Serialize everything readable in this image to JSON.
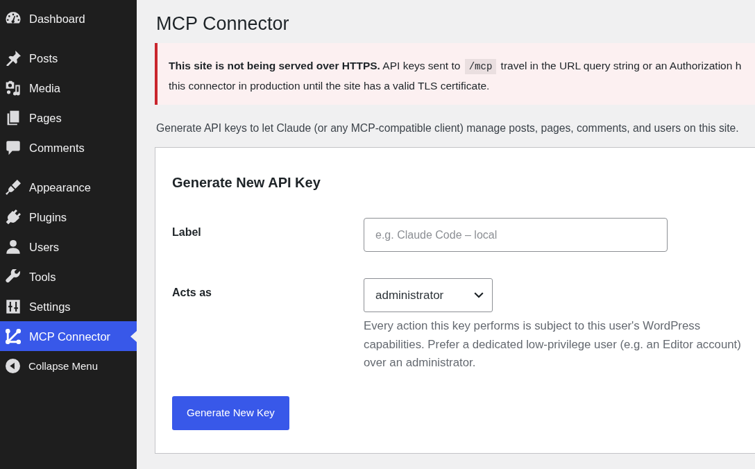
{
  "sidebar": {
    "groups": [
      {
        "items": [
          {
            "label": "Dashboard",
            "selected": false
          }
        ]
      },
      {
        "items": [
          {
            "label": "Posts",
            "selected": false
          },
          {
            "label": "Media",
            "selected": false
          },
          {
            "label": "Pages",
            "selected": false
          },
          {
            "label": "Comments",
            "selected": false
          }
        ]
      },
      {
        "items": [
          {
            "label": "Appearance",
            "selected": false
          },
          {
            "label": "Plugins",
            "selected": false
          },
          {
            "label": "Users",
            "selected": false
          },
          {
            "label": "Tools",
            "selected": false
          },
          {
            "label": "Settings",
            "selected": false
          },
          {
            "label": "MCP Connector",
            "selected": true
          }
        ]
      }
    ],
    "collapse_button": {
      "label": "Collapse Menu"
    }
  },
  "page_title": "MCP Connector",
  "notice": {
    "lines": [
      [
        {
          "kind": "text",
          "text": "**This site is not being served over HTTPS.** API keys sent to"
        },
        {
          "kind": "code",
          "text": "/mcp"
        },
        {
          "kind": "text",
          "text": "travel in the URL query string or an Authorization h"
        }
      ],
      [
        {
          "kind": "text",
          "text": "this connector in production until the site has a valid TLS certificate."
        }
      ]
    ]
  },
  "intro": "Generate API keys to let Claude (or any MCP-compatible client) manage posts, pages, comments, and users on this site.",
  "card": {
    "title": "Generate New API Key",
    "fields": [
      {
        "kind": "text",
        "label": "Label",
        "placeholder": "e.g. Claude Code – local"
      },
      {
        "kind": "select",
        "label": "Acts as",
        "value": "administrator",
        "help": "Every action this key performs is subject to this user's WordPress capabilities. Prefer a dedicated low-privilege user (e.g. an Editor account) over an administrator."
      }
    ],
    "submit_button": "Generate New Key"
  }
}
